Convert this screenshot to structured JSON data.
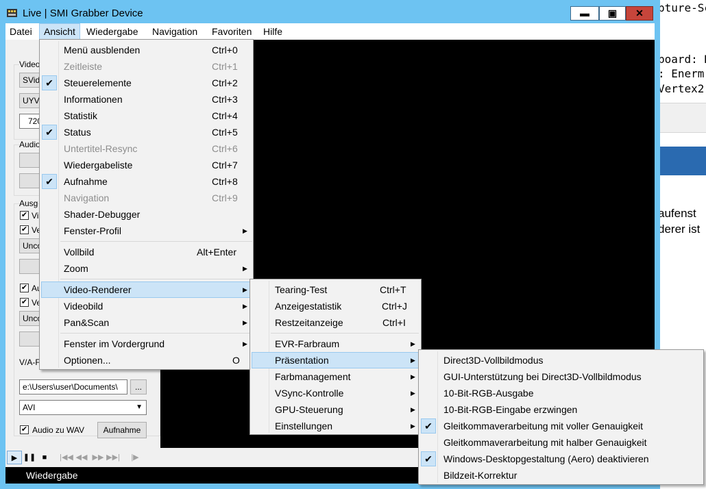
{
  "window": {
    "title": "Live | SMI Grabber Device",
    "minimize_label": "▬",
    "maximize_label": "▣",
    "close_label": "✕"
  },
  "menubar": [
    "Datei",
    "Ansicht",
    "Wiedergabe",
    "Navigation",
    "Favoriten",
    "Hilfe"
  ],
  "background_window": {
    "lines": [
      "pture-Sc",
      "board: N",
      ": Enerm",
      "Vertex2"
    ],
    "lines2": [
      "aufenst",
      "derer ist"
    ]
  },
  "left_panel": {
    "video_group": "Video",
    "video_source": "SVid",
    "video_format": "UYVY",
    "video_size": "720",
    "audio_group": "Audio",
    "output_group": "Ausg",
    "output_check1": "Vi",
    "output_check2": "Ve",
    "compression1": "Unco",
    "check3": "Au",
    "check4": "Ve",
    "compression2": "Unco",
    "va_label": "V/A-F",
    "path_field": "e:\\Users\\user\\Documents\\",
    "browse_button": "...",
    "container": "AVI",
    "audio_wav_label": "Audio zu WAV",
    "record_button": "Aufnahme"
  },
  "statusbar": {
    "text": "Wiedergabe"
  },
  "ansicht_menu": [
    {
      "label": "Menü ausblenden",
      "shortcut": "Ctrl+0",
      "checked": false,
      "disabled": false
    },
    {
      "label": "Zeitleiste",
      "shortcut": "Ctrl+1",
      "checked": false,
      "disabled": true
    },
    {
      "label": "Steuerelemente",
      "shortcut": "Ctrl+2",
      "checked": true,
      "disabled": false
    },
    {
      "label": "Informationen",
      "shortcut": "Ctrl+3",
      "checked": false,
      "disabled": false
    },
    {
      "label": "Statistik",
      "shortcut": "Ctrl+4",
      "checked": false,
      "disabled": false
    },
    {
      "label": "Status",
      "shortcut": "Ctrl+5",
      "checked": true,
      "disabled": false
    },
    {
      "label": "Untertitel-Resync",
      "shortcut": "Ctrl+6",
      "checked": false,
      "disabled": true
    },
    {
      "label": "Wiedergabeliste",
      "shortcut": "Ctrl+7",
      "checked": false,
      "disabled": false
    },
    {
      "label": "Aufnahme",
      "shortcut": "Ctrl+8",
      "checked": true,
      "disabled": false
    },
    {
      "label": "Navigation",
      "shortcut": "Ctrl+9",
      "checked": false,
      "disabled": true
    },
    {
      "label": "Shader-Debugger",
      "shortcut": "",
      "checked": false,
      "disabled": false
    },
    {
      "label": "Fenster-Profil",
      "shortcut": "",
      "submenu": true
    },
    {
      "label": "Vollbild",
      "shortcut": "Alt+Enter"
    },
    {
      "label": "Zoom",
      "shortcut": "",
      "submenu": true
    },
    {
      "label": "Video-Renderer",
      "shortcut": "",
      "submenu": true,
      "highlighted": true
    },
    {
      "label": "Videobild",
      "shortcut": "",
      "submenu": true
    },
    {
      "label": "Pan&Scan",
      "shortcut": "",
      "submenu": true
    },
    {
      "label": "Fenster im Vordergrund",
      "shortcut": "",
      "submenu": true
    },
    {
      "label": "Optionen...",
      "shortcut": "O"
    }
  ],
  "renderer_menu": [
    {
      "label": "Tearing-Test",
      "shortcut": "Ctrl+T"
    },
    {
      "label": "Anzeigestatistik",
      "shortcut": "Ctrl+J"
    },
    {
      "label": "Restzeitanzeige",
      "shortcut": "Ctrl+I"
    },
    {
      "label": "EVR-Farbraum",
      "submenu": true
    },
    {
      "label": "Präsentation",
      "submenu": true,
      "highlighted": true
    },
    {
      "label": "Farbmanagement",
      "submenu": true
    },
    {
      "label": "VSync-Kontrolle",
      "submenu": true
    },
    {
      "label": "GPU-Steuerung",
      "submenu": true
    },
    {
      "label": "Einstellungen",
      "submenu": true
    }
  ],
  "presentation_menu": [
    {
      "label": "Direct3D-Vollbildmodus",
      "checked": false
    },
    {
      "label": "GUI-Unterstützung bei Direct3D-Vollbildmodus",
      "checked": false
    },
    {
      "label": "10-Bit-RGB-Ausgabe",
      "checked": false
    },
    {
      "label": "10-Bit-RGB-Eingabe erzwingen",
      "checked": false
    },
    {
      "label": "Gleitkommaverarbeitung mit voller Genauigkeit",
      "checked": true
    },
    {
      "label": "Gleitkommaverarbeitung mit halber Genauigkeit",
      "checked": false
    },
    {
      "label": "Windows-Desktopgestaltung (Aero) deaktivieren",
      "checked": true
    },
    {
      "label": "Bildzeit-Korrektur",
      "checked": false
    }
  ],
  "icons": {
    "check": "✔",
    "submenu_arrow": "▶"
  }
}
